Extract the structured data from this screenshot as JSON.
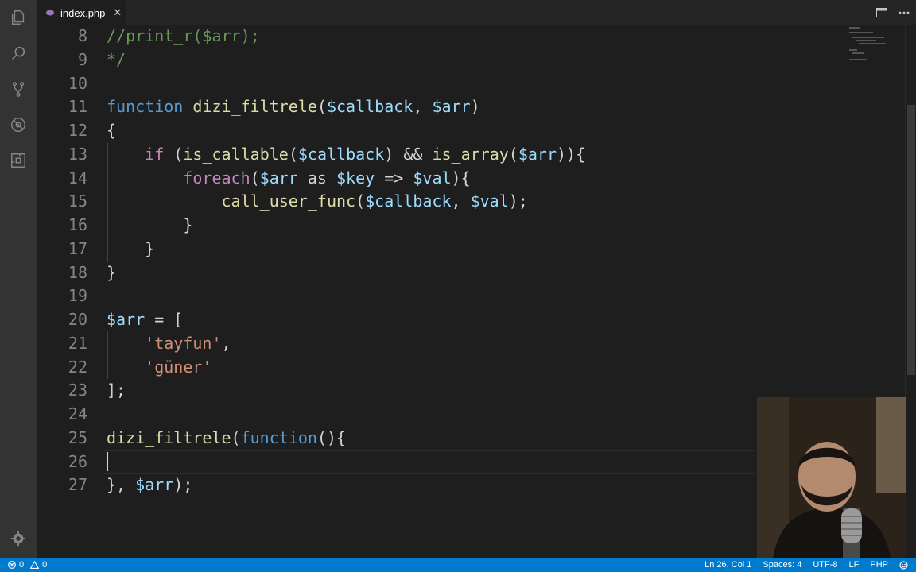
{
  "tab": {
    "filename": "index.php",
    "close_glyph": "✕"
  },
  "status": {
    "errors": "0",
    "warnings": "0",
    "position": "Ln 26, Col 1",
    "spaces": "Spaces: 4",
    "encoding": "UTF-8",
    "eol": "LF",
    "language": "PHP"
  },
  "code_lines": [
    {
      "n": "8",
      "tokens": [
        {
          "t": "//print_r($arr);",
          "c": "cm"
        }
      ]
    },
    {
      "n": "9",
      "tokens": [
        {
          "t": "*/",
          "c": "cm"
        }
      ]
    },
    {
      "n": "10",
      "tokens": []
    },
    {
      "n": "11",
      "tokens": [
        {
          "t": "function",
          "c": "kw2"
        },
        {
          "t": " ",
          "c": "pl"
        },
        {
          "t": "dizi_filtrele",
          "c": "fn"
        },
        {
          "t": "(",
          "c": "pl"
        },
        {
          "t": "$callback",
          "c": "var"
        },
        {
          "t": ", ",
          "c": "pl"
        },
        {
          "t": "$arr",
          "c": "var"
        },
        {
          "t": ")",
          "c": "pl"
        }
      ]
    },
    {
      "n": "12",
      "tokens": [
        {
          "t": "{",
          "c": "pl"
        }
      ]
    },
    {
      "n": "13",
      "tokens": [
        {
          "t": "    ",
          "c": "pl"
        },
        {
          "t": "if",
          "c": "kw"
        },
        {
          "t": " (",
          "c": "pl"
        },
        {
          "t": "is_callable",
          "c": "fn"
        },
        {
          "t": "(",
          "c": "pl"
        },
        {
          "t": "$callback",
          "c": "var"
        },
        {
          "t": ") && ",
          "c": "pl"
        },
        {
          "t": "is_array",
          "c": "fn"
        },
        {
          "t": "(",
          "c": "pl"
        },
        {
          "t": "$arr",
          "c": "var"
        },
        {
          "t": ")){",
          "c": "pl"
        }
      ]
    },
    {
      "n": "14",
      "tokens": [
        {
          "t": "        ",
          "c": "pl"
        },
        {
          "t": "foreach",
          "c": "kw"
        },
        {
          "t": "(",
          "c": "pl"
        },
        {
          "t": "$arr",
          "c": "var"
        },
        {
          "t": " as ",
          "c": "pl"
        },
        {
          "t": "$key",
          "c": "var"
        },
        {
          "t": " => ",
          "c": "pl"
        },
        {
          "t": "$val",
          "c": "var"
        },
        {
          "t": "){",
          "c": "pl"
        }
      ]
    },
    {
      "n": "15",
      "tokens": [
        {
          "t": "            ",
          "c": "pl"
        },
        {
          "t": "call_user_func",
          "c": "fn"
        },
        {
          "t": "(",
          "c": "pl"
        },
        {
          "t": "$callback",
          "c": "var"
        },
        {
          "t": ", ",
          "c": "pl"
        },
        {
          "t": "$val",
          "c": "var"
        },
        {
          "t": ");",
          "c": "pl"
        }
      ]
    },
    {
      "n": "16",
      "tokens": [
        {
          "t": "        }",
          "c": "pl"
        }
      ]
    },
    {
      "n": "17",
      "tokens": [
        {
          "t": "    }",
          "c": "pl"
        }
      ]
    },
    {
      "n": "18",
      "tokens": [
        {
          "t": "}",
          "c": "pl"
        }
      ]
    },
    {
      "n": "19",
      "tokens": []
    },
    {
      "n": "20",
      "tokens": [
        {
          "t": "$arr",
          "c": "var"
        },
        {
          "t": " = [",
          "c": "pl"
        }
      ]
    },
    {
      "n": "21",
      "tokens": [
        {
          "t": "    ",
          "c": "pl"
        },
        {
          "t": "'tayfun'",
          "c": "str"
        },
        {
          "t": ",",
          "c": "pl"
        }
      ]
    },
    {
      "n": "22",
      "tokens": [
        {
          "t": "    ",
          "c": "pl"
        },
        {
          "t": "'güner'",
          "c": "str"
        }
      ]
    },
    {
      "n": "23",
      "tokens": [
        {
          "t": "];",
          "c": "pl"
        }
      ]
    },
    {
      "n": "24",
      "tokens": []
    },
    {
      "n": "25",
      "tokens": [
        {
          "t": "dizi_filtrele",
          "c": "fn"
        },
        {
          "t": "(",
          "c": "pl"
        },
        {
          "t": "function",
          "c": "kw2"
        },
        {
          "t": "(){",
          "c": "pl"
        }
      ]
    },
    {
      "n": "26",
      "tokens": []
    },
    {
      "n": "27",
      "tokens": [
        {
          "t": "}, ",
          "c": "pl"
        },
        {
          "t": "$arr",
          "c": "var"
        },
        {
          "t": ");",
          "c": "pl"
        }
      ]
    }
  ],
  "activity_icons": [
    "explorer-icon",
    "search-icon",
    "source-control-icon",
    "debug-icon",
    "extensions-icon"
  ],
  "colors": {
    "statusbar": "#007acc",
    "activitybar": "#333333",
    "editor": "#1e1e1e"
  }
}
